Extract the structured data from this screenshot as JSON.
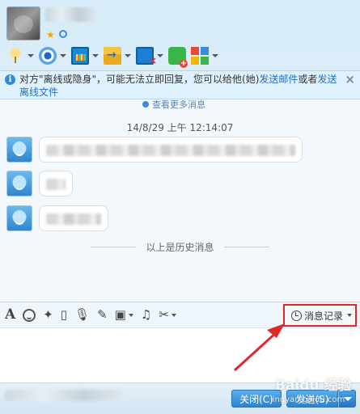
{
  "header": {
    "toolbar_icons": [
      "voice-call-icon",
      "video-call-icon",
      "screen-share-icon",
      "send-file-icon",
      "remote-desktop-icon",
      "create-discussion-icon",
      "apps-icon"
    ]
  },
  "notice": {
    "icon": "i",
    "text_before": "对方\"离线或隐身\"，可能无法立即回复，您可以给他(她)",
    "link_email": "发送邮件",
    "text_middle": "或者",
    "link_offline_file": "发送离线文件",
    "close": "×"
  },
  "chat": {
    "more_history": "查看更多消息",
    "timestamp": "14/8/29 上午 12:14:07",
    "history_separator": "以上是历史消息"
  },
  "input_toolbar": {
    "icons": [
      "font-icon",
      "emoji-icon",
      "magic-icon",
      "vibrate-icon",
      "voice-message-icon",
      "handwrite-icon",
      "image-icon",
      "music-icon",
      "screenshot-icon"
    ],
    "font_glyph": "A",
    "history_label": "消息记录"
  },
  "footer": {
    "close_label": "关闭(C)",
    "send_label": "发送(S)"
  },
  "watermark": {
    "text": "Baidu 经验",
    "sub": "jingyan.baidu.com"
  },
  "colors": {
    "accent": "#2c83cf",
    "highlight_red": "#e0282a",
    "link": "#1f6fc8"
  }
}
